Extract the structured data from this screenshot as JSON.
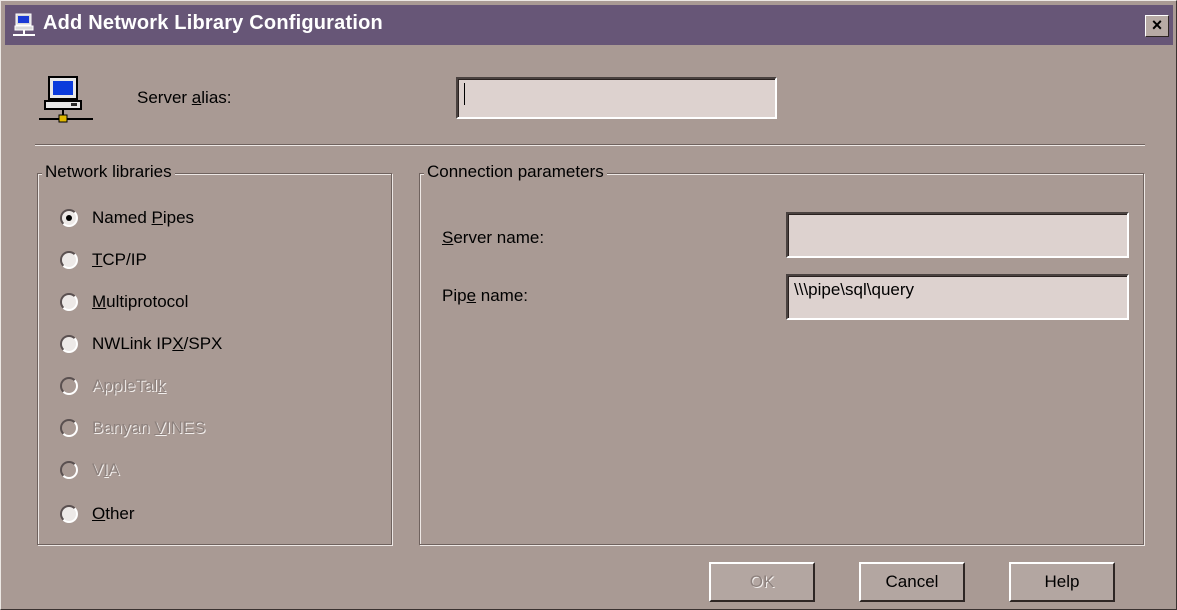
{
  "window": {
    "title": "Add Network Library Configuration",
    "close_label": "×"
  },
  "alias": {
    "label_pre": "Server ",
    "label_accel": "a",
    "label_post": "lias:",
    "value": ""
  },
  "network_libraries": {
    "title": "Network libraries",
    "options": [
      {
        "pre": "Named ",
        "accel": "P",
        "post": "ipes",
        "checked": true,
        "disabled": false
      },
      {
        "pre": "",
        "accel": "T",
        "post": "CP/IP",
        "checked": false,
        "disabled": false
      },
      {
        "pre": "",
        "accel": "M",
        "post": "ultiprotocol",
        "checked": false,
        "disabled": false
      },
      {
        "pre": "NWLink IP",
        "accel": "X",
        "post": "/SPX",
        "checked": false,
        "disabled": false
      },
      {
        "pre": "AppleTal",
        "accel": "k",
        "post": "",
        "checked": false,
        "disabled": true
      },
      {
        "pre": "Banyan ",
        "accel": "V",
        "post": "INES",
        "checked": false,
        "disabled": true
      },
      {
        "pre": "V",
        "accel": "I",
        "post": "A",
        "checked": false,
        "disabled": true
      },
      {
        "pre": "",
        "accel": "O",
        "post": "ther",
        "checked": false,
        "disabled": false
      }
    ]
  },
  "connection": {
    "title": "Connection parameters",
    "server_name": {
      "pre": "",
      "accel": "S",
      "post": "erver name:",
      "value": ""
    },
    "pipe_name": {
      "pre": "Pip",
      "accel": "e",
      "post": " name:",
      "value": "\\\\\\pipe\\sql\\query"
    }
  },
  "buttons": {
    "ok": "OK",
    "cancel": "Cancel",
    "help": "Help"
  }
}
